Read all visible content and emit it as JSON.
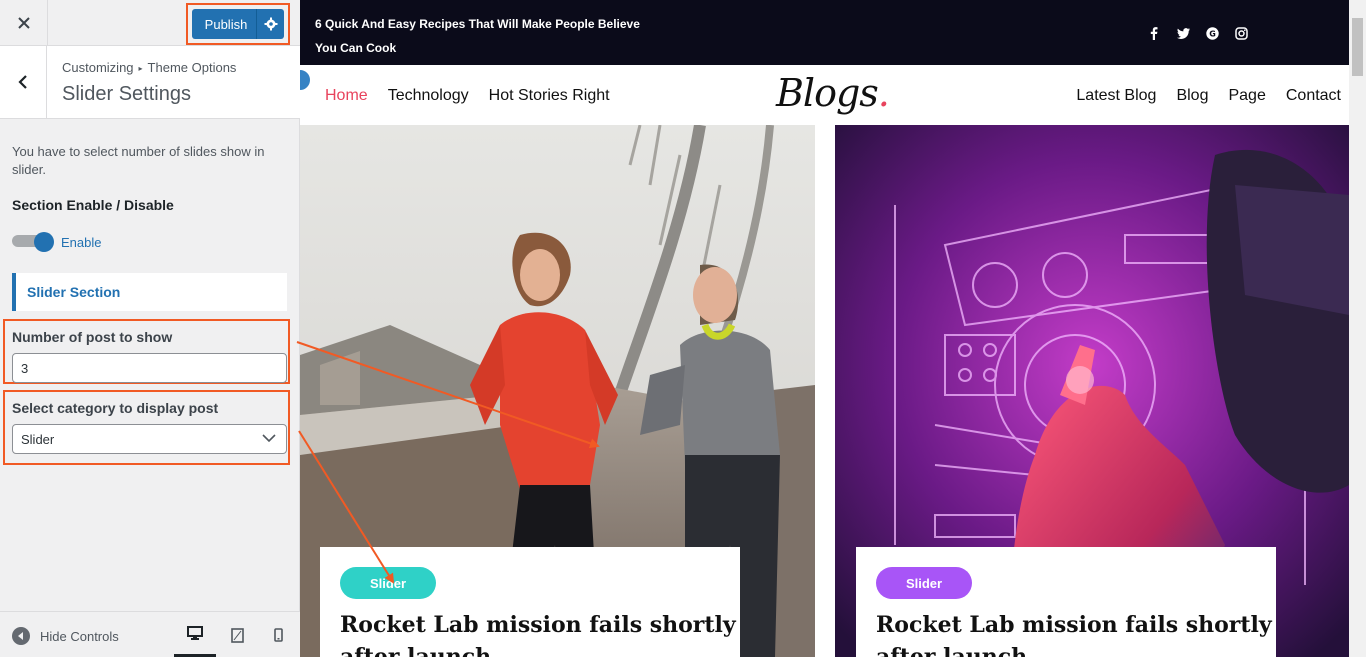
{
  "customizer": {
    "close_icon": "close-icon",
    "publish_label": "Publish",
    "breadcrumb_root": "Customizing",
    "breadcrumb_parent": "Theme Options",
    "section_title": "Slider Settings",
    "description": "You have to select number of slides show in slider.",
    "enable_heading": "Section Enable / Disable",
    "toggle_label": "Enable",
    "slider_section_label": "Slider Section",
    "posts_label": "Number of post to show",
    "posts_value": "3",
    "category_label": "Select category to display post",
    "category_value": "Slider",
    "hide_controls_label": "Hide Controls",
    "accent_color": "#2271b1",
    "highlight_color": "#f15a24"
  },
  "site": {
    "topbar_headline": "6 Quick And Easy Recipes That Will Make People Believe You Can Cook",
    "social_icons": [
      "facebook-icon",
      "twitter-icon",
      "google-plus-icon",
      "instagram-icon"
    ],
    "nav_left": [
      "Home",
      "Technology",
      "Hot Stories Right"
    ],
    "logo_text": "Blogs",
    "logo_dot": ".",
    "nav_right": [
      "Latest Blog",
      "Blog",
      "Page",
      "Contact"
    ],
    "brand_color": "#e8435d",
    "cards": [
      {
        "badge": "Slider",
        "badge_color": "#2fd1c7",
        "title": "Rocket Lab mission fails shortly after launch"
      },
      {
        "badge": "Slider",
        "badge_color": "#a855f7",
        "title": "Rocket Lab mission fails shortly after launch"
      }
    ]
  }
}
